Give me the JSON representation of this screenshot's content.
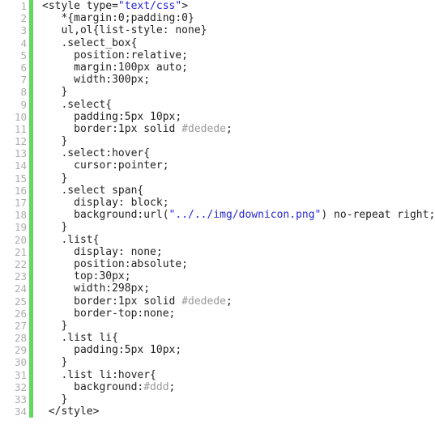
{
  "editor": {
    "language": "css",
    "background_color": "#ffffff",
    "text_color": "#222222",
    "line_number_color": "#adadad",
    "change_bar_color": "#62d862",
    "string_color": "#2727d6",
    "hex_literal_color": "#9a9a9a",
    "first_line_number": 1,
    "last_line_number": 34,
    "total_lines": 34
  },
  "lines": [
    {
      "number": "1",
      "tokens": [
        {
          "t": "<style type=",
          "c": "plain"
        },
        {
          "t": "\"text/css\"",
          "c": "string"
        },
        {
          "t": ">",
          "c": "plain"
        }
      ]
    },
    {
      "number": "2",
      "tokens": [
        {
          "t": "   *{margin:0;padding:0}",
          "c": "plain"
        }
      ]
    },
    {
      "number": "3",
      "tokens": [
        {
          "t": "   ul,ol{list-style: none}",
          "c": "plain"
        }
      ]
    },
    {
      "number": "4",
      "tokens": [
        {
          "t": "   .select_box{",
          "c": "plain"
        }
      ]
    },
    {
      "number": "5",
      "tokens": [
        {
          "t": "     position:relative;",
          "c": "plain"
        }
      ]
    },
    {
      "number": "6",
      "tokens": [
        {
          "t": "     margin:100px auto;",
          "c": "plain"
        }
      ]
    },
    {
      "number": "7",
      "tokens": [
        {
          "t": "     width:300px;",
          "c": "plain"
        }
      ]
    },
    {
      "number": "8",
      "tokens": [
        {
          "t": "   }",
          "c": "plain"
        }
      ]
    },
    {
      "number": "9",
      "tokens": [
        {
          "t": "   .select{",
          "c": "plain"
        }
      ]
    },
    {
      "number": "10",
      "tokens": [
        {
          "t": "     padding:5px 10px;",
          "c": "plain"
        }
      ]
    },
    {
      "number": "11",
      "tokens": [
        {
          "t": "     border:1px solid ",
          "c": "plain"
        },
        {
          "t": "#dedede",
          "c": "hex"
        },
        {
          "t": ";",
          "c": "plain"
        }
      ]
    },
    {
      "number": "12",
      "tokens": [
        {
          "t": "   }",
          "c": "plain"
        }
      ]
    },
    {
      "number": "13",
      "tokens": [
        {
          "t": "   .select:hover{",
          "c": "plain"
        }
      ]
    },
    {
      "number": "14",
      "tokens": [
        {
          "t": "     cursor:pointer;",
          "c": "plain"
        }
      ]
    },
    {
      "number": "15",
      "tokens": [
        {
          "t": "   }",
          "c": "plain"
        }
      ]
    },
    {
      "number": "16",
      "tokens": [
        {
          "t": "   .select span{",
          "c": "plain"
        }
      ]
    },
    {
      "number": "17",
      "tokens": [
        {
          "t": "     display: block;",
          "c": "plain"
        }
      ]
    },
    {
      "number": "18",
      "tokens": [
        {
          "t": "     background:url(",
          "c": "plain"
        },
        {
          "t": "\"../../img/downicon.png\"",
          "c": "string"
        },
        {
          "t": ") no-repeat right;",
          "c": "plain"
        }
      ]
    },
    {
      "number": "19",
      "tokens": [
        {
          "t": "   }",
          "c": "plain"
        }
      ]
    },
    {
      "number": "20",
      "tokens": [
        {
          "t": "   .list{",
          "c": "plain"
        }
      ]
    },
    {
      "number": "21",
      "tokens": [
        {
          "t": "     display: none;",
          "c": "plain"
        }
      ]
    },
    {
      "number": "22",
      "tokens": [
        {
          "t": "     position:absolute;",
          "c": "plain"
        }
      ]
    },
    {
      "number": "23",
      "tokens": [
        {
          "t": "     top:30px;",
          "c": "plain"
        }
      ]
    },
    {
      "number": "24",
      "tokens": [
        {
          "t": "     width:298px;",
          "c": "plain"
        }
      ]
    },
    {
      "number": "25",
      "tokens": [
        {
          "t": "     border:1px solid ",
          "c": "plain"
        },
        {
          "t": "#dedede",
          "c": "hex"
        },
        {
          "t": ";",
          "c": "plain"
        }
      ]
    },
    {
      "number": "26",
      "tokens": [
        {
          "t": "     border-top:none;",
          "c": "plain"
        }
      ]
    },
    {
      "number": "27",
      "tokens": [
        {
          "t": "   }",
          "c": "plain"
        }
      ]
    },
    {
      "number": "28",
      "tokens": [
        {
          "t": "   .list li{",
          "c": "plain"
        }
      ]
    },
    {
      "number": "29",
      "tokens": [
        {
          "t": "     padding:5px 10px;",
          "c": "plain"
        }
      ]
    },
    {
      "number": "30",
      "tokens": [
        {
          "t": "   }",
          "c": "plain"
        }
      ]
    },
    {
      "number": "31",
      "tokens": [
        {
          "t": "   .list li:hover{",
          "c": "plain"
        }
      ]
    },
    {
      "number": "32",
      "tokens": [
        {
          "t": "     background:",
          "c": "plain"
        },
        {
          "t": "#ddd",
          "c": "hex"
        },
        {
          "t": ";",
          "c": "plain"
        }
      ]
    },
    {
      "number": "33",
      "tokens": [
        {
          "t": "   }",
          "c": "plain"
        }
      ]
    },
    {
      "number": "34",
      "tokens": [
        {
          "t": " </style>",
          "c": "plain"
        }
      ]
    }
  ]
}
